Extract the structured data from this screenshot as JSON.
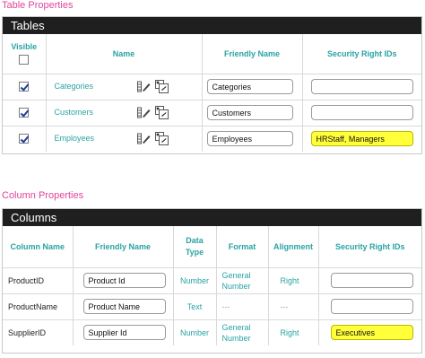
{
  "table_section": {
    "caption": "Table Properties",
    "header": "Tables",
    "columns": {
      "visible": "Visible",
      "name": "Name",
      "friendly_name": "Friendly Name",
      "security": "Security Right IDs"
    },
    "rows": [
      {
        "visible": true,
        "name": "Categories",
        "friendly_name": "Categories",
        "security": ""
      },
      {
        "visible": true,
        "name": "Customers",
        "friendly_name": "Customers",
        "security": ""
      },
      {
        "visible": true,
        "name": "Employees",
        "friendly_name": "Employees",
        "security": "HRStaff, Managers"
      }
    ]
  },
  "column_section": {
    "caption": "Column Properties",
    "header": "Columns",
    "columns": {
      "column_name": "Column Name",
      "friendly_name": "Friendly Name",
      "data_type": "Data Type",
      "format": "Format",
      "alignment": "Alignment",
      "security": "Security Right IDs"
    },
    "rows": [
      {
        "column_name": "ProductID",
        "friendly_name": "Product Id",
        "data_type": "Number",
        "format": "General Number",
        "alignment": "Right",
        "security": ""
      },
      {
        "column_name": "ProductName",
        "friendly_name": "Product Name",
        "data_type": "Text",
        "format": "---",
        "alignment": "---",
        "security": ""
      },
      {
        "column_name": "SupplierID",
        "friendly_name": "Supplier Id",
        "data_type": "Number",
        "format": "General Number",
        "alignment": "Right",
        "security": "Executives"
      }
    ]
  },
  "colors": {
    "accent": "#2aa3a3",
    "caption": "#e0449c",
    "header_bg": "#1f1f1f",
    "highlight": "#ffff3a"
  },
  "icons": {
    "edit": "pencil-icon",
    "copy": "copy-icon"
  }
}
